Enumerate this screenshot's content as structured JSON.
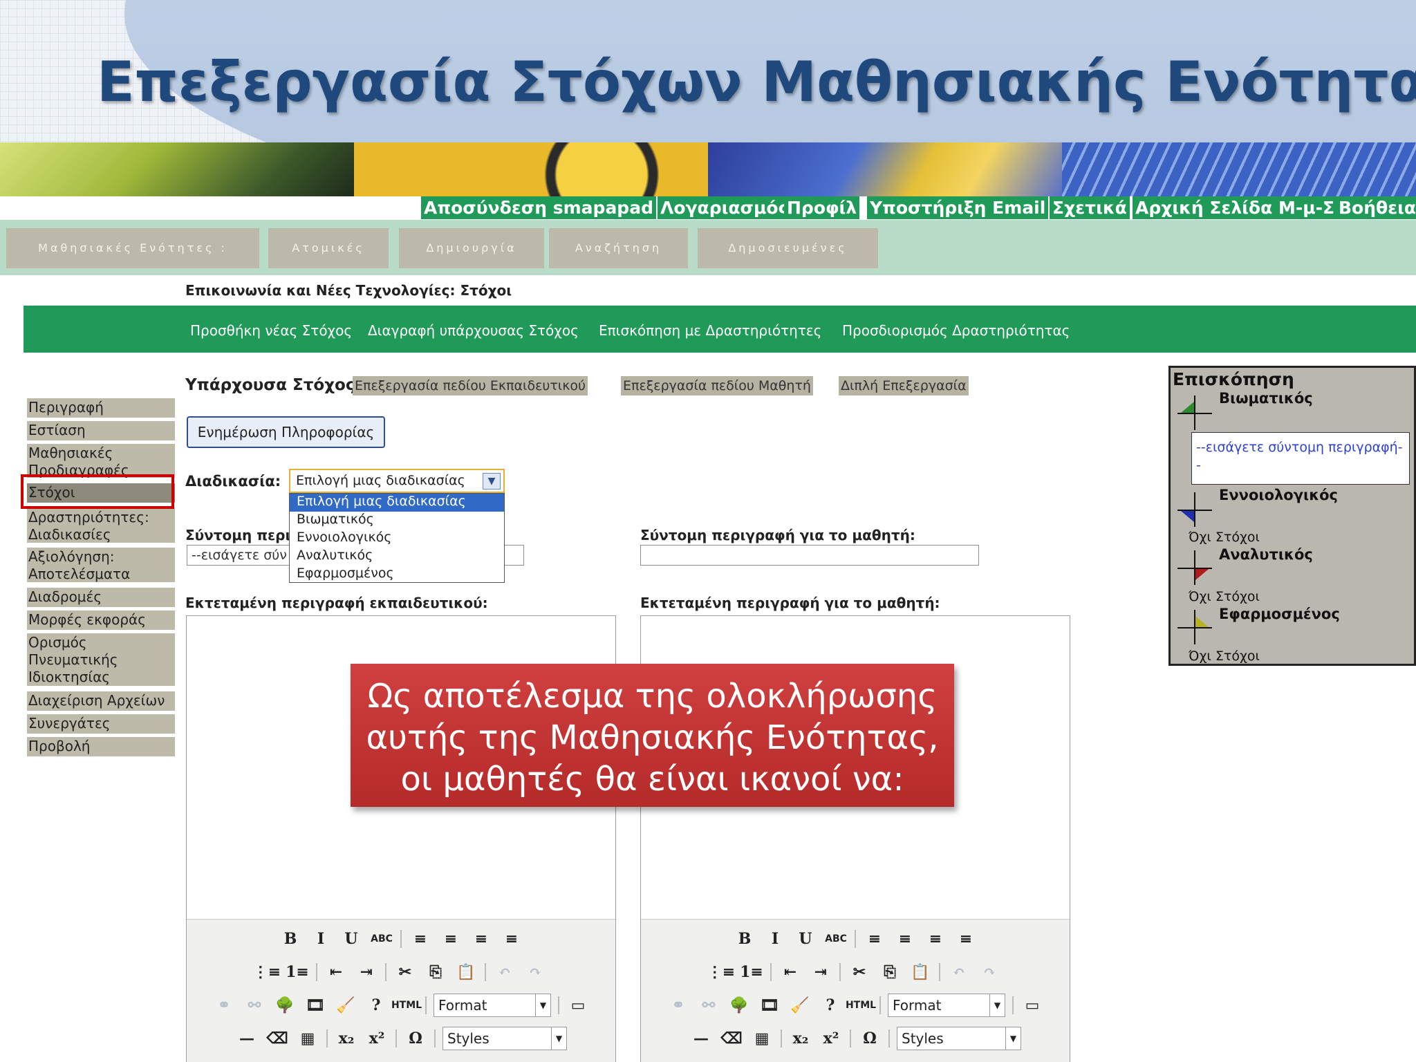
{
  "slide": {
    "title": "Επεξεργασία Στόχων Μαθησιακής Ενότητας",
    "callout": [
      "Ως αποτέλεσμα της ολοκλήρωσης",
      "αυτής της Μαθησιακής Ενότητας,",
      "οι μαθητές θα είναι ικανοί να:"
    ]
  },
  "topnav": [
    "Αποσύνδεση smapapad",
    "Λογαριασμός",
    "Προφίλ",
    "Υποστήριξη Email",
    "Σχετικά",
    "Αρχική Σελίδα Μ-μ-Σ",
    "Βοήθεια"
  ],
  "navtabs": [
    "Μαθησιακές Ενότητες :",
    "Ατομικές",
    "Δημιουργία",
    "Αναζήτηση",
    "Δημοσιευμένες"
  ],
  "breadcrumb": "Επικοινωνία και Νέες Τεχνολογίες: Στόχοι",
  "actions": [
    "Προσθήκη νέας Στόχος",
    "Διαγραφή υπάρχουσας Στόχος",
    "Επισκόπηση με Δραστηριότητες",
    "Προσδιορισμός Δραστηριότητας"
  ],
  "sidebar": [
    {
      "label": "Περιγραφή"
    },
    {
      "label": "Εστίαση"
    },
    {
      "label": "Μαθησιακές Προδιαγραφές"
    },
    {
      "label": "Στόχοι",
      "active": true
    },
    {
      "label": "Δραστηριότητες: Διαδικασίες"
    },
    {
      "label": "Αξιολόγηση: Αποτελέσματα"
    },
    {
      "label": "Διαδρομές"
    },
    {
      "label": "Μορφές εκφοράς"
    },
    {
      "label": "Ορισμός Πνευματικής Ιδιοκτησίας"
    },
    {
      "label": "Διαχείριση Αρχείων"
    },
    {
      "label": "Συνεργάτες"
    },
    {
      "label": "Προβολή"
    }
  ],
  "form": {
    "existing_label": "Υπάρχουσα Στόχος",
    "edit_tabs": [
      "Επεξεργασία πεδίου Εκπαιδευτικού",
      "Επεξεργασία πεδίου Μαθητή",
      "Διπλή Επεξεργασία"
    ],
    "update_button": "Ενημέρωση Πληροφορίας",
    "process_label": "Διαδικασία:",
    "process_value": "Επιλογή μιας διαδικασίας",
    "process_options": [
      "Επιλογή μιας διαδικασίας",
      "Βιωματικός",
      "Εννοιολογικός",
      "Αναλυτικός",
      "Εφαρμοσμένος"
    ],
    "short_teacher_label": "Σύντομη περι",
    "short_teacher_value": "--εισάγετε σύν",
    "short_student_label": "Σύντομη περιγραφή για το μαθητή:",
    "short_student_value": "",
    "long_teacher_label": "Εκτεταμένη περιγραφή εκπαιδευτικού:",
    "long_student_label": "Εκτεταμένη περιγραφή για το μαθητή:"
  },
  "editor_toolbar": {
    "row1": [
      {
        "g": "B",
        "icon": "bold-icon"
      },
      {
        "g": "I",
        "icon": "italic-icon"
      },
      {
        "g": "U",
        "icon": "underline-icon"
      },
      {
        "g": "ABC",
        "icon": "strikethrough-icon"
      },
      {
        "g": "≡",
        "icon": "align-left-icon"
      },
      {
        "g": "≡",
        "icon": "align-center-icon"
      },
      {
        "g": "≡",
        "icon": "align-right-icon"
      },
      {
        "g": "≡",
        "icon": "justify-icon"
      }
    ],
    "row2": [
      {
        "g": "⋮≡",
        "icon": "bullet-list-icon"
      },
      {
        "g": "1≡",
        "icon": "numbered-list-icon"
      },
      {
        "g": "⇤",
        "icon": "outdent-icon"
      },
      {
        "g": "⇥",
        "icon": "indent-icon"
      },
      {
        "g": "✂",
        "icon": "cut-icon"
      },
      {
        "g": "⎘",
        "icon": "copy-icon"
      },
      {
        "g": "📋",
        "icon": "paste-icon"
      },
      {
        "g": "↶",
        "icon": "undo-icon"
      },
      {
        "g": "↷",
        "icon": "redo-icon"
      }
    ],
    "row3": [
      {
        "g": "⚭",
        "icon": "link-icon"
      },
      {
        "g": "⚯",
        "icon": "unlink-icon"
      },
      {
        "g": "🌳",
        "icon": "image-icon"
      },
      {
        "g": "🎞",
        "icon": "media-icon"
      },
      {
        "g": "🧹",
        "icon": "cleanup-icon"
      },
      {
        "g": "?",
        "icon": "help-icon"
      },
      {
        "g": "HTML",
        "icon": "html-icon"
      }
    ],
    "format_select": "Format",
    "row4": [
      {
        "g": "—",
        "icon": "horizontal-rule-icon"
      },
      {
        "g": "⌫",
        "icon": "eraser-icon"
      },
      {
        "g": "▦",
        "icon": "table-icon"
      },
      {
        "g": "x₂",
        "icon": "subscript-icon"
      },
      {
        "g": "x²",
        "icon": "superscript-icon"
      },
      {
        "g": "Ω",
        "icon": "special-char-icon"
      }
    ],
    "styles_select": "Styles"
  },
  "overview": {
    "title": "Επισκόπηση",
    "categories": [
      {
        "name": "Βιωματικός",
        "color": "#2e8b2e"
      },
      {
        "name": "Εννοιολογικός",
        "color": "#1f2fb0"
      },
      {
        "name": "Αναλυτικός",
        "color": "#b01a1a"
      },
      {
        "name": "Εφαρμοσμένος",
        "color": "#b8b020"
      }
    ],
    "description": "--εισάγετε σύντομη περιγραφή--",
    "no_goals": "Όχι Στόχοι"
  },
  "colors": {
    "green": "#1f9a59",
    "title_blue": "#1f497d",
    "callout_red": "#c43535",
    "highlight": "#cc0000"
  }
}
